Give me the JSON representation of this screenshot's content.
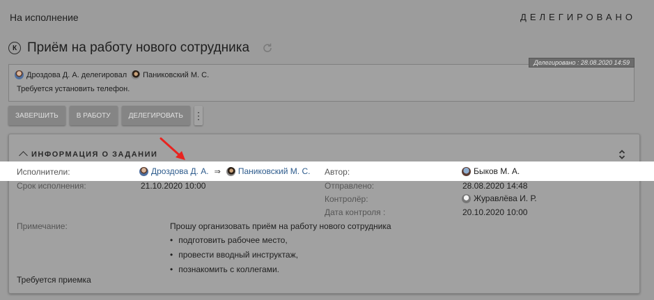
{
  "header": {
    "breadcrumb": "На исполнение",
    "status": "ДЕЛЕГИРОВАНО"
  },
  "task": {
    "badge_letter": "К",
    "title": "Приём на работу нового сотрудника"
  },
  "delegation": {
    "stamp": "Делегировано : 28.08.2020 14:59",
    "from": "Дроздова Д. А. делегировал",
    "to": "Паниковский М. С.",
    "comment": "Требуется установить телефон."
  },
  "actions": {
    "complete": "ЗАВЕРШИТЬ",
    "to_work": "В РАБОТУ",
    "delegate": "ДЕЛЕГИРОВАТЬ",
    "more": "⋮"
  },
  "info": {
    "section_title": "ИНФОРМАЦИЯ О ЗАДАНИИ",
    "executors_label": "Исполнители:",
    "executor_from": "Дроздова Д. А.",
    "executor_arrow": "⇒",
    "executor_to": "Паниковский М. С.",
    "deadline_label": "Срок исполнения:",
    "deadline_value": "21.10.2020 10:00",
    "author_label": "Автор:",
    "author_value": "Быков М. А.",
    "sent_label": "Отправлено:",
    "sent_value": "28.08.2020 14:48",
    "controller_label": "Контролёр:",
    "controller_value": "Журавлёва И. Р.",
    "control_date_label": "Дата контроля :",
    "control_date_value": "20.10.2020 10:00",
    "note_label": "Примечание:",
    "note_intro": "Прошу организовать приём на работу нового сотрудника",
    "note_items": [
      "подготовить рабочее место,",
      "провести вводный инструктаж,",
      "познакомить с коллегами."
    ],
    "footer": "Требуется приемка"
  },
  "colors": {
    "highlight": "#ffffff",
    "link": "#2d5b8c",
    "annotation_arrow": "#e8231f"
  }
}
